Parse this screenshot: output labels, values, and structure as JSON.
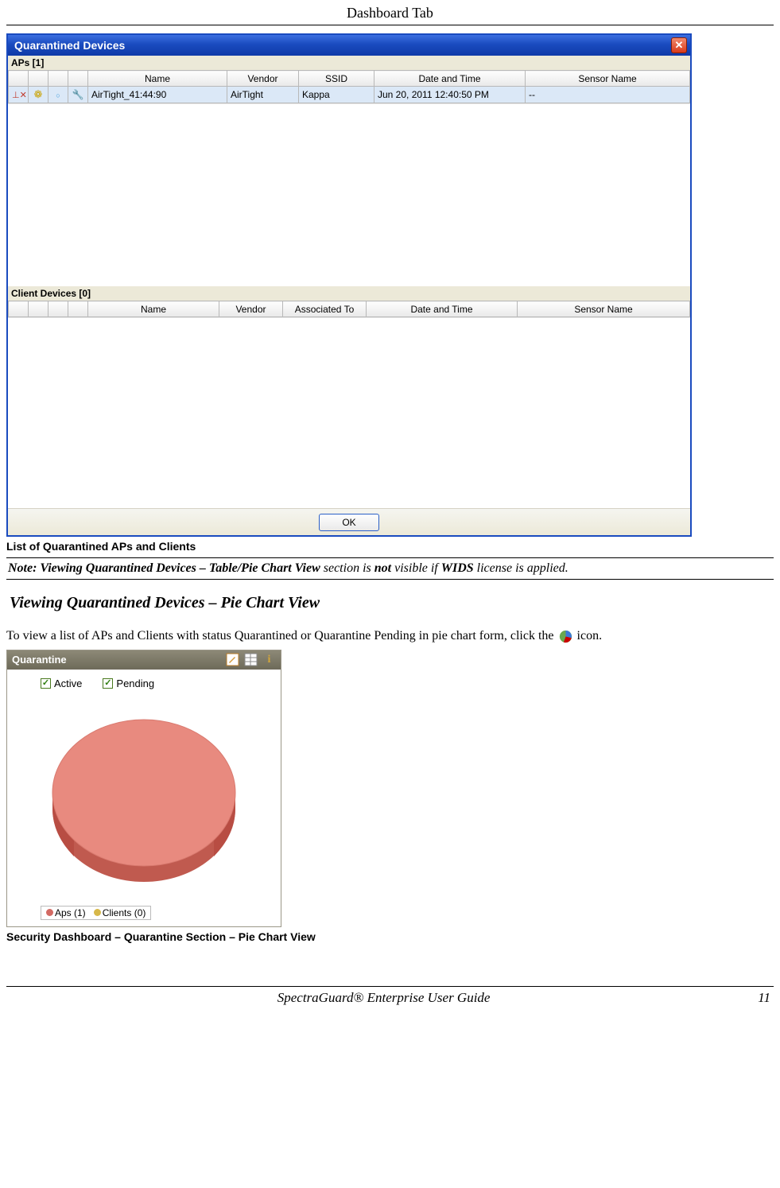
{
  "page_header": "Dashboard Tab",
  "dialog": {
    "title": "Quarantined Devices",
    "close_glyph": "✕",
    "ap_section_label": "APs [1]",
    "ap_columns": {
      "c1": "",
      "c2": "",
      "c3": "",
      "c4": "",
      "name": "Name",
      "vendor": "Vendor",
      "ssid": "SSID",
      "datetime": "Date and Time",
      "sensor": "Sensor Name"
    },
    "ap_row": {
      "name": "AirTight_41:44:90",
      "vendor": "AirTight",
      "ssid": "Kappa",
      "datetime": "Jun 20, 2011 12:40:50 PM",
      "sensor": "--"
    },
    "client_section_label": "Client Devices [0]",
    "client_columns": {
      "c1": "",
      "c2": "",
      "c3": "",
      "c4": "",
      "name": "Name",
      "vendor": "Vendor",
      "assoc": "Associated To",
      "datetime": "Date and Time",
      "sensor": "Sensor Name"
    },
    "ok_label": "OK"
  },
  "caption1": "List of Quarantined APs and Clients",
  "note": {
    "prefix": "Note: Viewing Quarantined Devices – Table/Pie Chart View",
    "mid1": " section is ",
    "not": "not",
    "mid2": " visible if ",
    "wids": "WIDS",
    "suffix": " license is applied."
  },
  "section_heading": "Viewing Quarantined Devices – Pie Chart View",
  "body_line": {
    "pre": "To view a list of APs and Clients with status Quarantined or Quarantine Pending in pie chart form, click the ",
    "post": " icon."
  },
  "widget": {
    "title": "Quarantine",
    "checkbox_active": "Active",
    "checkbox_pending": "Pending",
    "legend_aps": "Aps (1)",
    "legend_clients": "Clients (0)"
  },
  "caption2": "Security Dashboard – Quarantine Section – Pie Chart View",
  "footer": {
    "guide": "SpectraGuard®  Enterprise User Guide",
    "page": "11"
  },
  "chart_data": {
    "type": "pie",
    "title": "Quarantine",
    "series": [
      {
        "name": "Aps",
        "value": 1,
        "color": "#e88a7f"
      },
      {
        "name": "Clients",
        "value": 0,
        "color": "#d7b84a"
      }
    ],
    "filters": {
      "Active": true,
      "Pending": true
    }
  }
}
